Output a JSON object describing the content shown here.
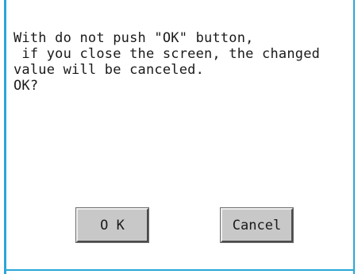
{
  "dialog": {
    "message_lines": [
      "With do not push \"OK\" button,",
      " if you close the screen, the changed",
      "value will be canceled.",
      "OK?"
    ],
    "ok_label": "O K",
    "cancel_label": "Cancel"
  },
  "colors": {
    "frame": "#2aa7d8",
    "button_face": "#c8c8c8",
    "text": "#1a1a1a"
  }
}
